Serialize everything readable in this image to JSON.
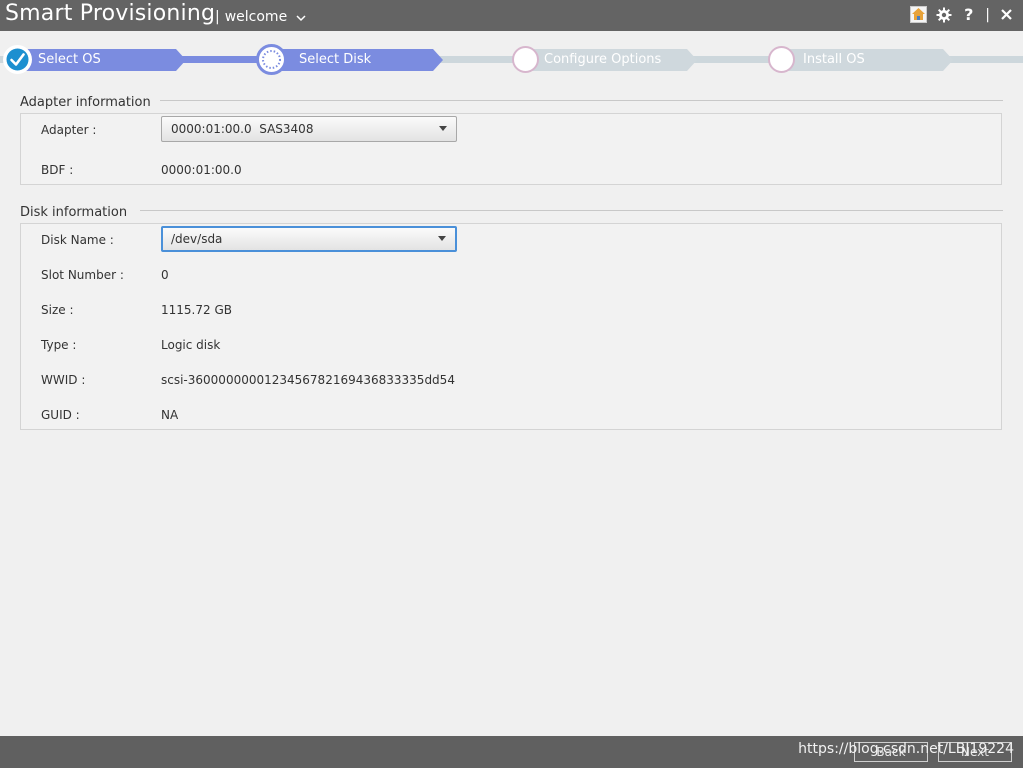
{
  "titlebar": {
    "app_title": "Smart Provisioning",
    "user_separator": "|",
    "user_label": "welcome",
    "icons": [
      "home-icon",
      "gear-icon",
      "help-icon",
      "close-icon"
    ],
    "help_glyph": "?",
    "divider": "|",
    "close_glyph": "✕"
  },
  "wizard": {
    "steps": [
      {
        "label": "Select OS",
        "state": "done"
      },
      {
        "label": "Select Disk",
        "state": "active"
      },
      {
        "label": "Configure Options",
        "state": "pending"
      },
      {
        "label": "Install OS",
        "state": "pending"
      }
    ]
  },
  "adapter_section": {
    "title": "Adapter information",
    "adapter_label": "Adapter :",
    "adapter_value": "0000:01:00.0  SAS3408",
    "bdf_label": "BDF :",
    "bdf_value": "0000:01:00.0"
  },
  "disk_section": {
    "title": "Disk information",
    "disk_name_label": "Disk Name :",
    "disk_name_value": "/dev/sda",
    "rows": [
      {
        "label": "Slot Number :",
        "value": "0"
      },
      {
        "label": "Size :",
        "value": "1115.72 GB"
      },
      {
        "label": "Type :",
        "value": "Logic disk"
      },
      {
        "label": "WWID :",
        "value": "scsi-3600000000123456782169436833335dd54"
      },
      {
        "label": "GUID :",
        "value": "NA"
      }
    ]
  },
  "footer": {
    "back_label": "Back",
    "next_label": "Next",
    "watermark": "https://blog.csdn.net/LBJ19224"
  },
  "colors": {
    "titlebar": "#646464",
    "accent": "#7b8ce0",
    "pending": "#cfd8dd",
    "focus": "#4a90d9"
  }
}
